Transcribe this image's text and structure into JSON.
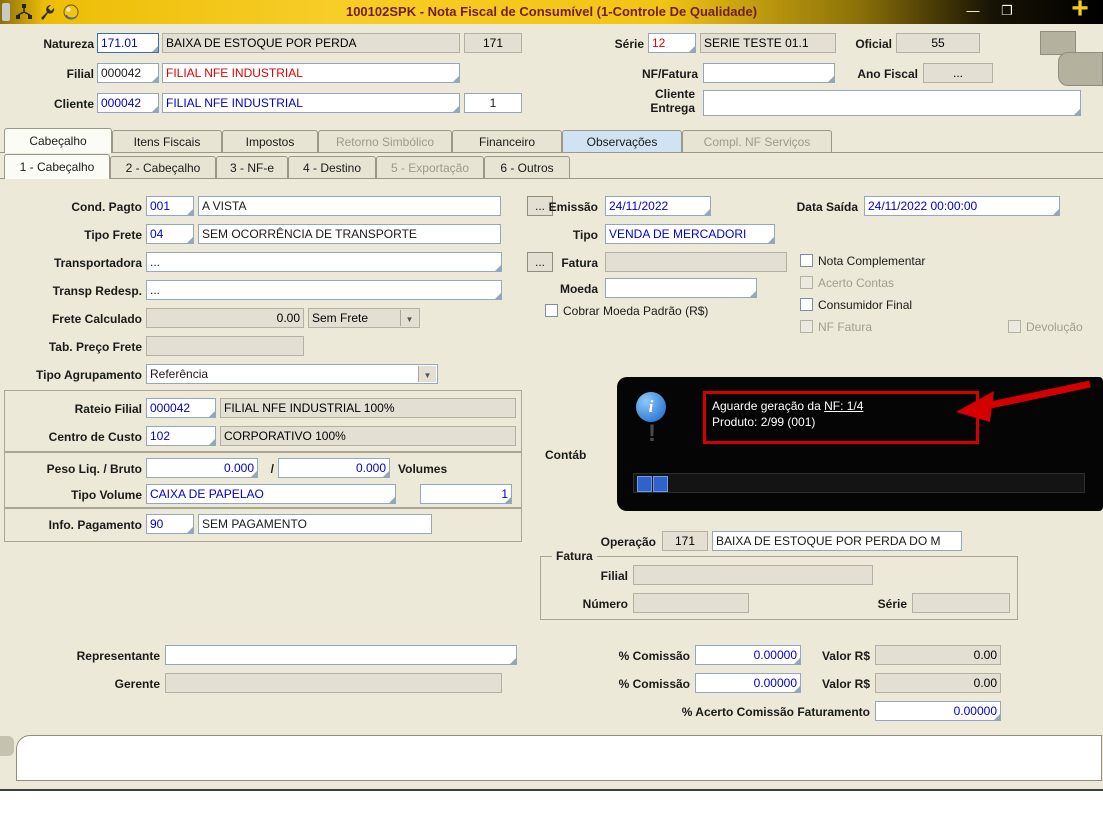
{
  "title_bar": {
    "title": "100102SPK - Nota Fiscal de Consumível (1-Controle De Qualidade)",
    "minimize_glyph": "—",
    "restore_glyph": "❐",
    "close_glyph": "+"
  },
  "header": {
    "natureza_label": "Natureza",
    "natureza_code": "171.01",
    "natureza_desc": "BAIXA DE ESTOQUE POR PERDA",
    "natureza_num": "171",
    "serie_label": "Série",
    "serie_code": "12",
    "serie_desc": "SERIE TESTE 01.1",
    "oficial_label": "Oficial",
    "oficial_value": "55",
    "filial_label": "Filial",
    "filial_code": "000042",
    "filial_desc": "FILIAL NFE INDUSTRIAL",
    "nf_fatura_label": "NF/Fatura",
    "nf_fatura_value": "",
    "ano_fiscal_label": "Ano Fiscal",
    "ano_fiscal_value": "...",
    "cliente_label": "Cliente",
    "cliente_code": "000042",
    "cliente_desc": "FILIAL NFE INDUSTRIAL",
    "cliente_loja": "1",
    "cliente_entrega_label_1": "Cliente",
    "cliente_entrega_label_2": "Entrega",
    "cliente_entrega_value": ""
  },
  "tabs_main": [
    {
      "label": "Cabeçalho",
      "state": "active"
    },
    {
      "label": "Itens Fiscais",
      "state": "normal"
    },
    {
      "label": "Impostos",
      "state": "normal"
    },
    {
      "label": "Retorno Simbólico",
      "state": "disabled"
    },
    {
      "label": "Financeiro",
      "state": "normal"
    },
    {
      "label": "Observações",
      "state": "highlight"
    },
    {
      "label": "Compl. NF Serviços",
      "state": "disabled"
    }
  ],
  "tabs_sub": [
    {
      "label": "1 - Cabeçalho",
      "state": "active"
    },
    {
      "label": "2 - Cabeçalho",
      "state": "normal"
    },
    {
      "label": "3 - NF-e",
      "state": "normal"
    },
    {
      "label": "4 - Destino",
      "state": "normal"
    },
    {
      "label": "5 - Exportação",
      "state": "disabled"
    },
    {
      "label": "6 - Outros",
      "state": "normal"
    }
  ],
  "left": {
    "cond_pagto_label": "Cond. Pagto",
    "cond_pagto_code": "001",
    "cond_pagto_desc": "A VISTA",
    "cond_pagto_lookup": "...",
    "tipo_frete_label": "Tipo Frete",
    "tipo_frete_code": "04",
    "tipo_frete_desc": "SEM OCORRÊNCIA DE TRANSPORTE",
    "transportadora_label": "Transportadora",
    "transportadora_value": "...",
    "transportadora_lookup": "...",
    "transp_redesp_label": "Transp Redesp.",
    "transp_redesp_value": "...",
    "frete_calculado_label": "Frete Calculado",
    "frete_calculado_value": "0.00",
    "frete_tipo_value": "Sem Frete",
    "tab_preco_frete_label": "Tab. Preço Frete",
    "tab_preco_frete_value": "",
    "tipo_agrupamento_label": "Tipo Agrupamento",
    "tipo_agrupamento_value": "Referência",
    "rateio_filial_label": "Rateio Filial",
    "rateio_filial_code": "000042",
    "rateio_filial_desc": "FILIAL NFE INDUSTRIAL 100%",
    "centro_custo_label": "Centro de Custo",
    "centro_custo_code": "102",
    "centro_custo_desc": "CORPORATIVO 100%",
    "peso_label": "Peso Liq. / Bruto",
    "peso_liq": "0.000",
    "peso_sep": "/",
    "peso_bruto": "0.000",
    "volumes_label": "Volumes",
    "volumes_value": "1",
    "tipo_volume_label": "Tipo Volume",
    "tipo_volume_value": "CAIXA DE PAPELAO",
    "info_pagamento_label": "Info. Pagamento",
    "info_pagamento_code": "90",
    "info_pagamento_desc": "SEM PAGAMENTO"
  },
  "right": {
    "emissao_label": "Emissão",
    "emissao_value": "24/11/2022",
    "data_saida_label": "Data Saída",
    "data_saida_value": "24/11/2022 00:00:00",
    "tipo_label": "Tipo",
    "tipo_value": "VENDA DE MERCADORI",
    "fatura_label": "Fatura",
    "fatura_value": "",
    "moeda_label": "Moeda",
    "moeda_value": "",
    "chk_nota_complementar": "Nota Complementar",
    "chk_acerto_contas": "Acerto Contas",
    "chk_cobrar_moeda": "Cobrar Moeda Padrão (R$)",
    "chk_consumidor_final": "Consumidor Final",
    "chk_nf_fatura": "NF Fatura",
    "chk_devolucao": "Devolução",
    "contab_label": "Contáb",
    "operacao_label": "Operação",
    "operacao_code": "171",
    "operacao_desc": "BAIXA DE ESTOQUE POR PERDA DO M",
    "fatura_group_label": "Fatura",
    "fg_filial_label": "Filial",
    "fg_filial_value": "",
    "fg_numero_label": "Número",
    "fg_numero_value": "",
    "fg_serie_label": "Série",
    "fg_serie_value": ""
  },
  "popup": {
    "line1_pre": "Aguarde geração da ",
    "line1_nf": "NF: 1/4",
    "line2": "Produto: 2/99 (001)"
  },
  "bottom": {
    "representante_label": "Representante",
    "representante_value": "",
    "gerente_label": "Gerente",
    "gerente_value": "",
    "comissao1_label": "% Comissão",
    "comissao1_value": "0.00000",
    "valor1_label": "Valor R$",
    "valor1_value": "0.00",
    "comissao2_label": "% Comissão",
    "comissao2_value": "0.00000",
    "valor2_label": "Valor R$",
    "valor2_value": "0.00",
    "acerto_label": "% Acerto Comissão Faturamento",
    "acerto_value": "0.00000"
  },
  "colors": {
    "accent_yellow": "#f2c318",
    "title_text": "#701f1f",
    "annotation_red": "#d40000",
    "editable_blue": "#0000cd",
    "alert_red_text": "#e00000",
    "popup_bg": "#000000",
    "progress_blue": "#2f63c9"
  }
}
